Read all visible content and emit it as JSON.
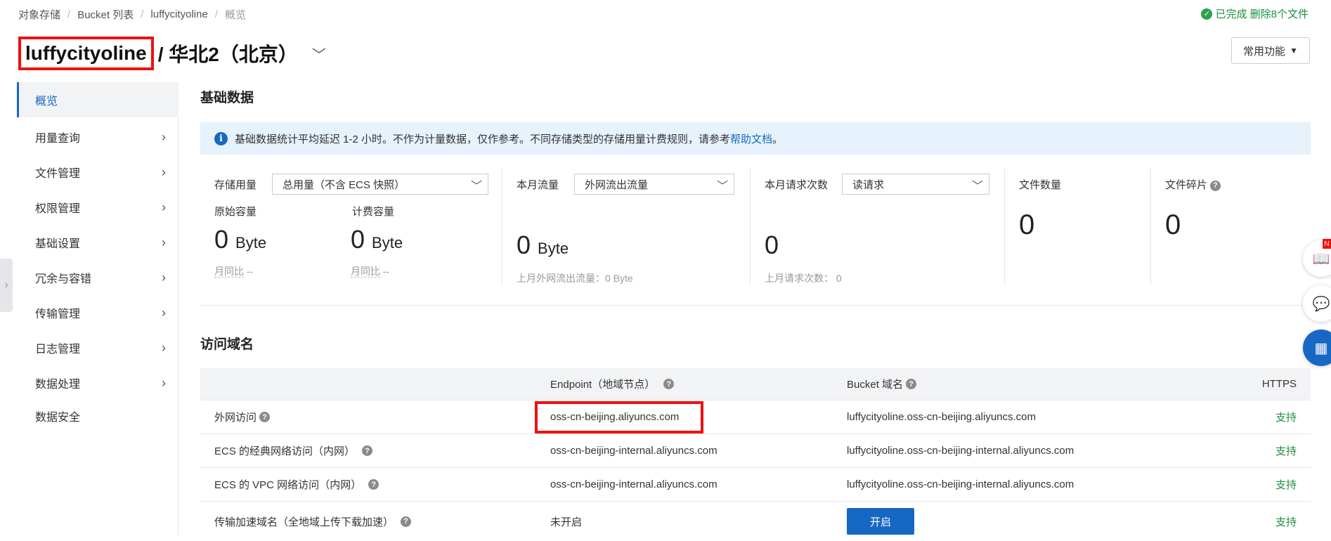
{
  "breadcrumb": [
    "对象存储",
    "Bucket 列表",
    "luffycityoline",
    "概览"
  ],
  "status": {
    "text": "已完成 删除8个文件",
    "color": "#1a8f3c"
  },
  "title": {
    "bucket": "luffycityoline",
    "region": "/ 华北2（北京）"
  },
  "quick_button": "常用功能",
  "sidebar": {
    "items": [
      {
        "label": "概览",
        "active": true
      },
      {
        "label": "用量查询"
      },
      {
        "label": "文件管理"
      },
      {
        "label": "权限管理"
      },
      {
        "label": "基础设置"
      },
      {
        "label": "冗余与容错"
      },
      {
        "label": "传输管理"
      },
      {
        "label": "日志管理"
      },
      {
        "label": "数据处理"
      },
      {
        "label": "数据安全"
      }
    ]
  },
  "basic": {
    "heading": "基础数据",
    "notice": "基础数据统计平均延迟 1-2 小时。不作为计量数据，仅作参考。不同存储类型的存储用量计费规则，请参考",
    "notice_link": "帮助文档",
    "notice_end": "。",
    "storage": {
      "label": "存储用量",
      "select": "总用量（不含 ECS 快照）",
      "raw_label": "原始容量",
      "raw_value": "0",
      "raw_unit": "Byte",
      "raw_mom": "月同比",
      "raw_mom_val": "--",
      "bill_label": "计费容量",
      "bill_value": "0",
      "bill_unit": "Byte",
      "bill_mom": "月同比",
      "bill_mom_val": "--"
    },
    "traffic": {
      "label": "本月流量",
      "select": "外网流出流量",
      "value": "0",
      "unit": "Byte",
      "last": "上月外网流出流量：0 Byte"
    },
    "requests": {
      "label": "本月请求次数",
      "select": "读请求",
      "value": "0",
      "last": "上月请求次数：",
      "last_val": "0"
    },
    "files": {
      "label": "文件数量",
      "value": "0"
    },
    "fragments": {
      "label": "文件碎片",
      "value": "0"
    }
  },
  "access": {
    "heading": "访问域名",
    "headers": {
      "endpoint": "Endpoint（地域节点）",
      "domain": "Bucket 域名",
      "https": "HTTPS"
    },
    "rows": [
      {
        "name": "外网访问",
        "help": true,
        "endpoint": "oss-cn-beijing.aliyuncs.com",
        "domain": "luffycityoline.oss-cn-beijing.aliyuncs.com",
        "https": "支持"
      },
      {
        "name": "ECS 的经典网络访问（内网）",
        "help": true,
        "endpoint": "oss-cn-beijing-internal.aliyuncs.com",
        "domain": "luffycityoline.oss-cn-beijing-internal.aliyuncs.com",
        "https": "支持"
      },
      {
        "name": "ECS 的 VPC 网络访问（内网）",
        "help": true,
        "endpoint": "oss-cn-beijing-internal.aliyuncs.com",
        "domain": "luffycityoline.oss-cn-beijing-internal.aliyuncs.com",
        "https": "支持"
      },
      {
        "name": "传输加速域名（全地域上传下载加速）",
        "help": true,
        "endpoint": "未开启",
        "button": "开启",
        "https": "支持"
      }
    ]
  },
  "floating_badge": "N"
}
